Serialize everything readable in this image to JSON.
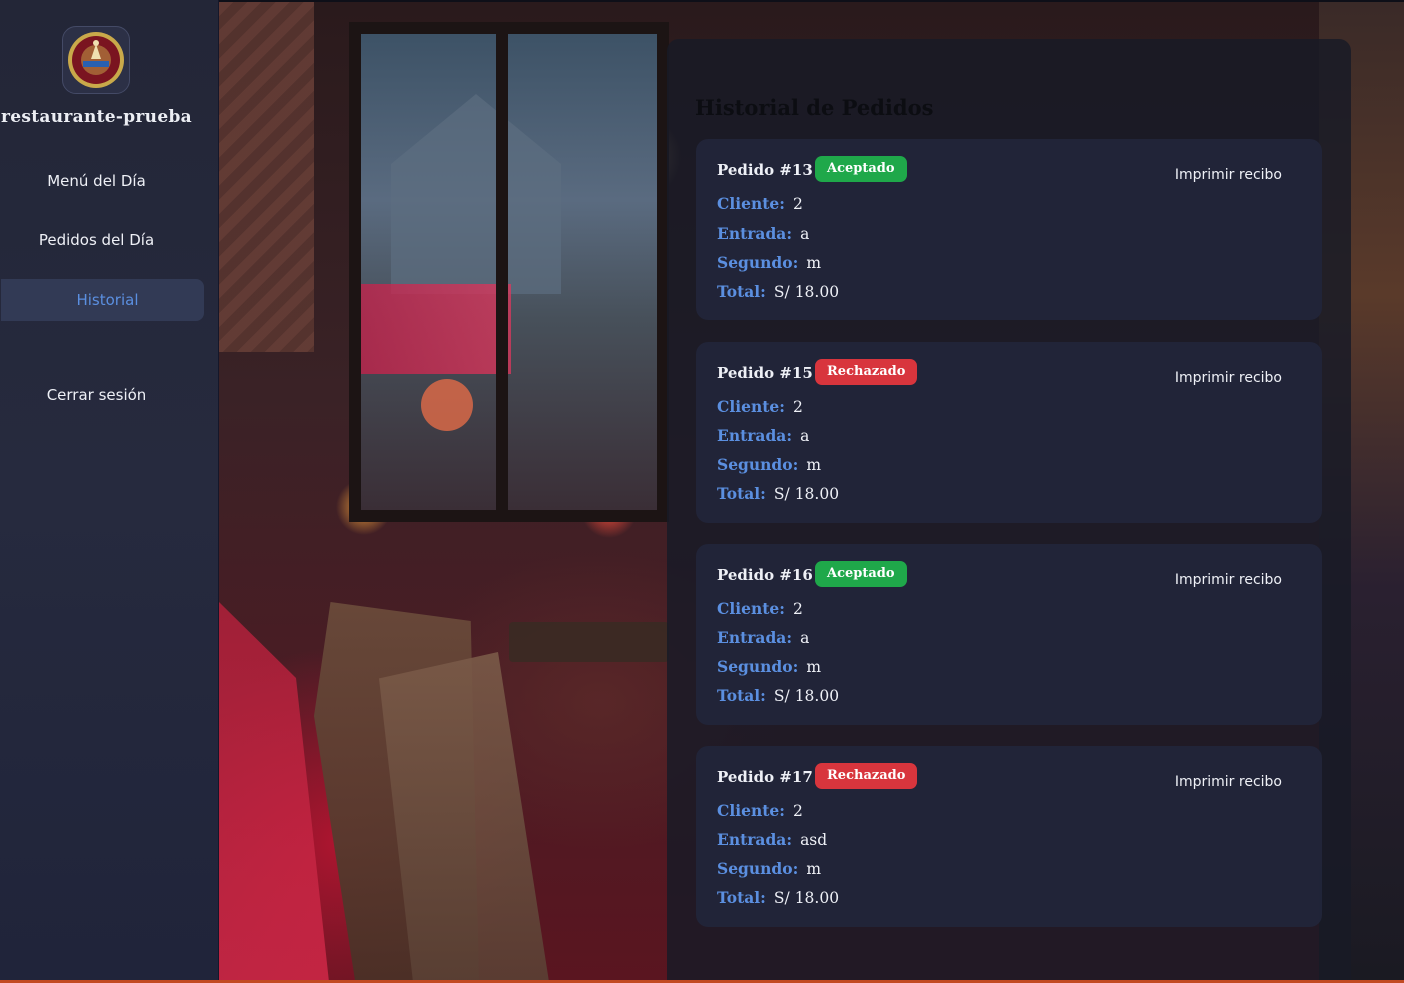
{
  "sidebar": {
    "brand": "restaurante-prueba",
    "items": [
      {
        "label": "Menú del Día"
      },
      {
        "label": "Pedidos del Día"
      },
      {
        "label": "Historial"
      }
    ],
    "logout": "Cerrar sesión"
  },
  "main": {
    "title": "Historial de Pedidos",
    "print_label": "Imprimir recibo",
    "field_labels": {
      "cliente": "Cliente:",
      "entrada": "Entrada:",
      "segundo": "Segundo:",
      "total": "Total:"
    },
    "orders": [
      {
        "title": "Pedido #13",
        "status": "Aceptado",
        "cliente": "2",
        "entrada": "a",
        "segundo": "m",
        "total": "S/ 18.00"
      },
      {
        "title": "Pedido #15",
        "status": "Rechazado",
        "cliente": "2",
        "entrada": "a",
        "segundo": "m",
        "total": "S/ 18.00"
      },
      {
        "title": "Pedido #16",
        "status": "Aceptado",
        "cliente": "2",
        "entrada": "a",
        "segundo": "m",
        "total": "S/ 18.00"
      },
      {
        "title": "Pedido #17",
        "status": "Rechazado",
        "cliente": "2",
        "entrada": "asd",
        "segundo": "m",
        "total": "S/ 18.00"
      }
    ]
  },
  "colors": {
    "accent": "#5b8fe0",
    "accepted": "#1fa84a",
    "rejected": "#d8353d",
    "sidebar": "#232637"
  }
}
